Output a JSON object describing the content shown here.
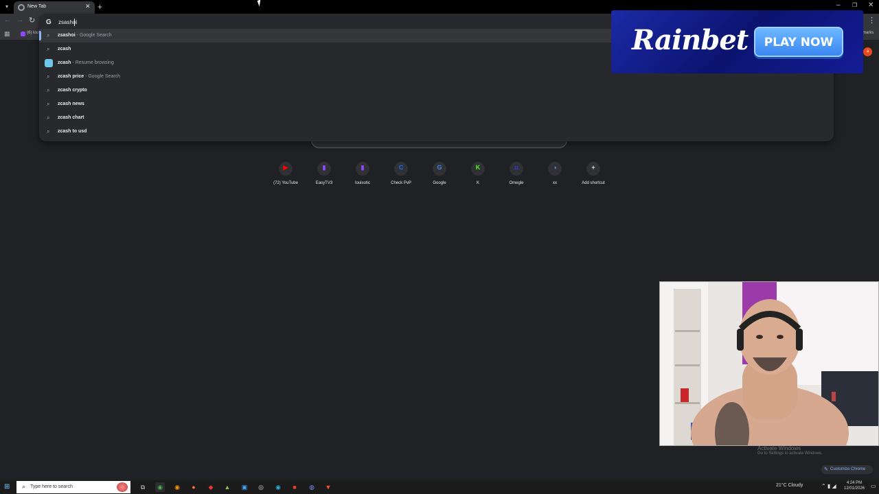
{
  "browser": {
    "tab": {
      "title": "New Tab"
    },
    "new_tab_symbol": "+",
    "bookmarks": {
      "first_item": "(6) lou",
      "all_bookmarks": "marks"
    }
  },
  "omnibox": {
    "query": "zsashoi",
    "suggestions": [
      {
        "bold": "zsashoi",
        "sub": " - Google Search",
        "icon": "search-icon",
        "selected": true
      },
      {
        "bold": "zcash",
        "sub": "",
        "icon": "search-icon"
      },
      {
        "bold": "zcash",
        "sub": " - Resume browsing",
        "icon": "site-favicon"
      },
      {
        "bold": "zcash price",
        "sub": " - Google Search",
        "icon": "search-icon"
      },
      {
        "bold": "zcash crypto",
        "sub": "",
        "icon": "search-icon"
      },
      {
        "bold": "zcash news",
        "sub": "",
        "icon": "search-icon"
      },
      {
        "bold": "zcash chart",
        "sub": "",
        "icon": "search-icon"
      },
      {
        "bold": "zcash to usd",
        "sub": "",
        "icon": "search-icon"
      }
    ]
  },
  "ad": {
    "brand": "Rainbet",
    "cta": "PLAY NOW"
  },
  "profile": {
    "badge": "a"
  },
  "shortcuts": [
    {
      "label": "(72) YouTube",
      "glyph": "▶",
      "color": "#ff0000"
    },
    {
      "label": "EasyTV3",
      "glyph": "▮",
      "color": "#9146ff"
    },
    {
      "label": "louisotic",
      "glyph": "▮",
      "color": "#9146ff"
    },
    {
      "label": "Check PvP",
      "glyph": "C",
      "color": "#1e6ff0"
    },
    {
      "label": "Google",
      "glyph": "G",
      "color": "#4285f4"
    },
    {
      "label": "K",
      "glyph": "K",
      "color": "#53fc18"
    },
    {
      "label": "Omegle",
      "glyph": "o",
      "color": "#2b3bd6"
    },
    {
      "label": "xx",
      "glyph": "◑",
      "color": "#5b8def"
    },
    {
      "label": "Add shortcut",
      "glyph": "+",
      "color": "#e8eaed"
    }
  ],
  "watermark": {
    "line1": "Activate Windows",
    "line2": "Go to Settings to activate Windows."
  },
  "customize": {
    "label": "Customize Chrome"
  },
  "taskbar": {
    "search_placeholder": "Type here to search",
    "weather": "21°C  Cloudy",
    "time": "4:24 PM",
    "date": "12/01/2026"
  }
}
